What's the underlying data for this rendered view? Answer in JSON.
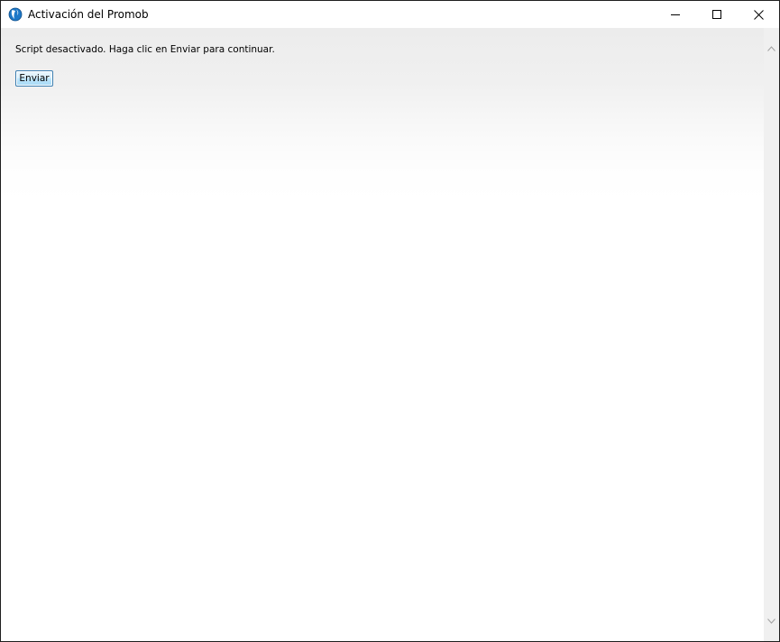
{
  "window": {
    "title": "Activación del Promob",
    "app_icon": "promob-globe-icon",
    "controls": {
      "minimize": "minimize-icon",
      "maximize": "maximize-icon",
      "close": "close-icon"
    }
  },
  "content": {
    "message": "Script desactivado. Haga clic en Enviar para continuar.",
    "submit_label": "Enviar"
  },
  "scrollbar": {
    "up_icon": "chevron-up-icon",
    "down_icon": "chevron-down-icon"
  },
  "colors": {
    "button_border": "#3c7fb1",
    "button_fill": "#bee6fd",
    "icon_blue": "#1e78c8"
  }
}
